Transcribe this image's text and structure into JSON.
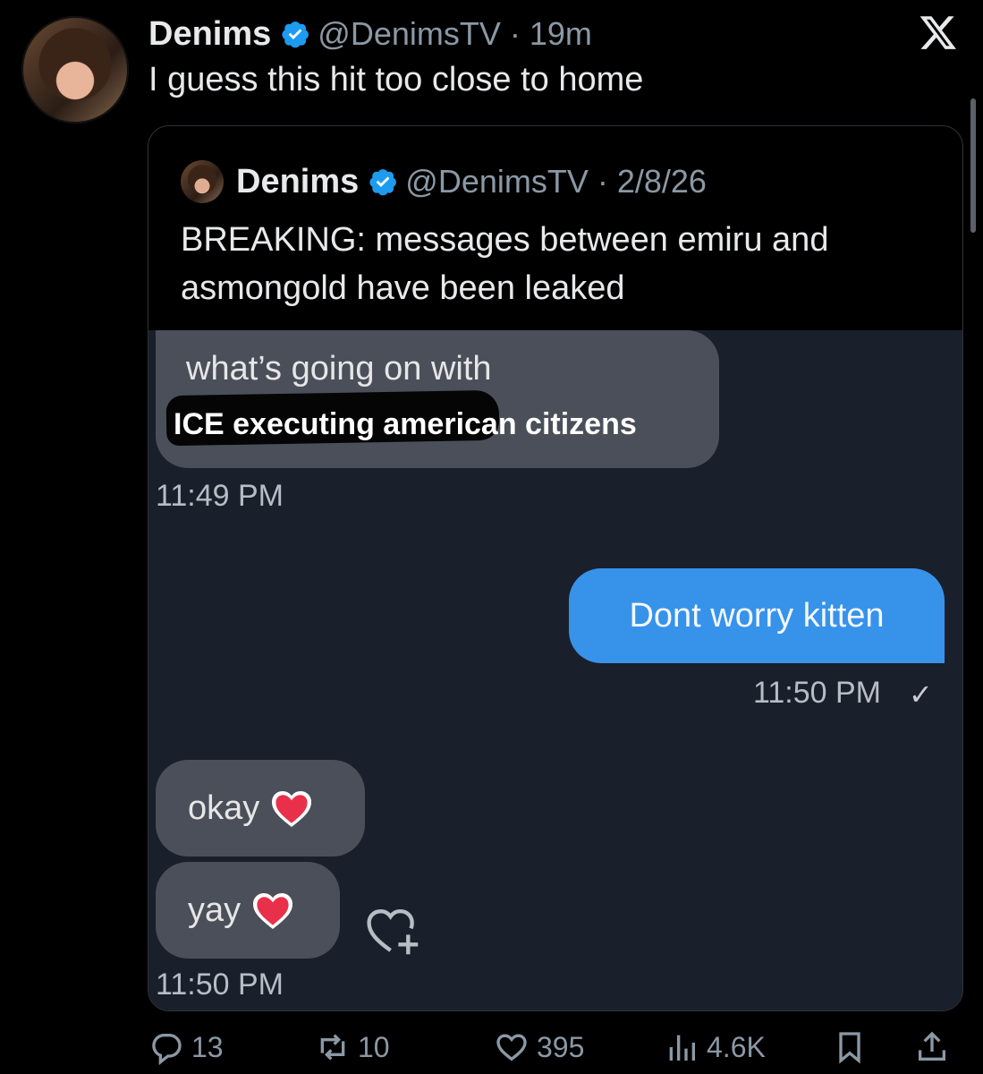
{
  "tweet": {
    "name": "Denims",
    "handle_time": "@DenimsTV · 19m",
    "text": "I guess this hit too close to home"
  },
  "quote": {
    "name": "Denims",
    "handle_time": "@DenimsTV · 2/8/26",
    "text": "BREAKING: messages between emiru and asmongold have been leaked"
  },
  "media": {
    "msg1_line1": "what’s going on with",
    "msg1_line2": "ICE executing american citizens",
    "time1": "11:49 PM",
    "msg2": "Dont worry kitten",
    "time2": "11:50 PM",
    "msg3": "okay",
    "msg4": "yay",
    "time3": "11:50 PM"
  },
  "actions": {
    "replies": "13",
    "reposts": "10",
    "likes": "395",
    "views": "4.6K"
  },
  "colors": {
    "background": "#000000",
    "verified": "#1d9bf0",
    "sent_bubble": "#3793ea",
    "received_bubble": "#4a4f5a"
  },
  "icons": [
    "verified-badge-icon",
    "x-logo-icon",
    "reply-icon",
    "repost-icon",
    "like-icon",
    "views-icon",
    "bookmark-icon",
    "share-icon",
    "heart-add-icon"
  ]
}
